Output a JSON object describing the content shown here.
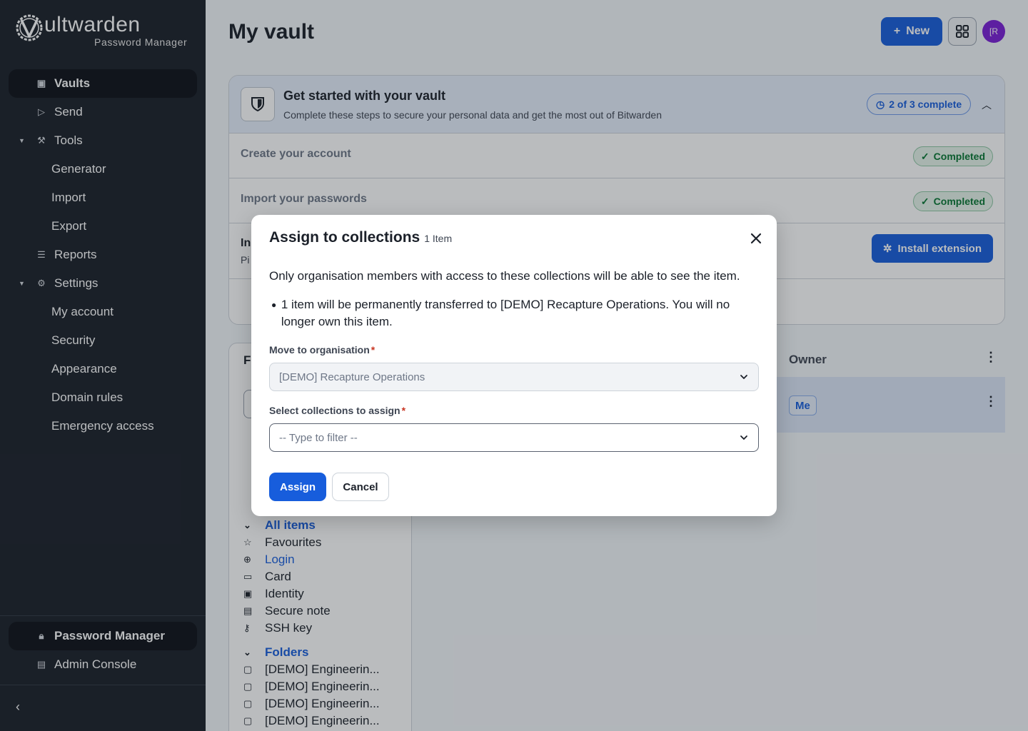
{
  "sidebar": {
    "logo": {
      "word": "ultwarden",
      "subtitle": "Password Manager"
    },
    "items": [
      {
        "label": "Vaults",
        "icon": "vault-icon"
      },
      {
        "label": "Send",
        "icon": "send-icon"
      },
      {
        "label": "Tools",
        "icon": "wrench-icon"
      },
      {
        "label": "Reports",
        "icon": "reports-icon"
      },
      {
        "label": "Settings",
        "icon": "gear-icon"
      }
    ],
    "tools_sub": [
      "Generator",
      "Import",
      "Export"
    ],
    "settings_sub": [
      "My account",
      "Security",
      "Appearance",
      "Domain rules",
      "Emergency access"
    ],
    "bottom": [
      {
        "label": "Password Manager",
        "icon": "lock-icon"
      },
      {
        "label": "Admin Console",
        "icon": "building-icon"
      }
    ]
  },
  "header": {
    "title": "My vault",
    "new_label": "New",
    "avatar_initials": "[R"
  },
  "onboarding": {
    "title": "Get started with your vault",
    "subtitle": "Complete these steps to secure your personal data and get the most out of Bitwarden",
    "progress": "2 of 3 complete",
    "tasks": [
      {
        "label": "Create your account",
        "status": "Completed"
      },
      {
        "label": "Import your passwords",
        "status": "Completed"
      }
    ],
    "partial_title": "In",
    "partial_sub": "Pi",
    "install_label": "Install extension"
  },
  "filters": {
    "head": "Fi",
    "all_items": "All items",
    "types": [
      "Favourites",
      "Login",
      "Card",
      "Identity",
      "Secure note",
      "SSH key"
    ],
    "folders_label": "Folders",
    "folders": [
      "[DEMO] Engineerin...",
      "[DEMO] Engineerin...",
      "[DEMO] Engineerin...",
      "[DEMO] Engineerin..."
    ]
  },
  "table": {
    "owner_header": "Owner",
    "owner_value": "Me"
  },
  "dialog": {
    "title": "Assign to collections",
    "count": "1 Item",
    "intro": "Only organisation members with access to these collections will be able to see the item.",
    "bullet": "1 item will be permanently transferred to [DEMO] Recapture Operations. You will no longer own this item.",
    "org_label": "Move to organisation",
    "org_value": "[DEMO] Recapture Operations",
    "collections_label": "Select collections to assign",
    "collections_placeholder": "-- Type to filter --",
    "required_mark": "*",
    "assign_label": "Assign",
    "cancel_label": "Cancel"
  },
  "colors": {
    "primary": "#175ddc",
    "sidebar_bg": "#1b2029",
    "success": "#077632",
    "required": "#c83522"
  }
}
